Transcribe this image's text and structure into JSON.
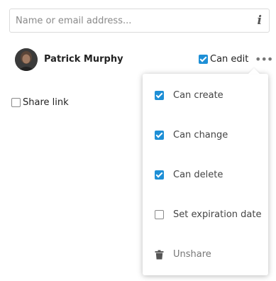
{
  "search": {
    "placeholder": "Name or email address..."
  },
  "share": {
    "user_name": "Patrick Murphy",
    "can_edit_label": "Can edit",
    "can_edit_checked": true
  },
  "share_link": {
    "label": "Share link",
    "checked": false
  },
  "menu": {
    "items": [
      {
        "label": "Can create",
        "checked": true
      },
      {
        "label": "Can change",
        "checked": true
      },
      {
        "label": "Can delete",
        "checked": true
      },
      {
        "label": "Set expiration date",
        "checked": false
      },
      {
        "label": "Unshare",
        "icon": "trash-icon"
      }
    ]
  },
  "colors": {
    "checkbox_accent": "#1e8fd6"
  }
}
